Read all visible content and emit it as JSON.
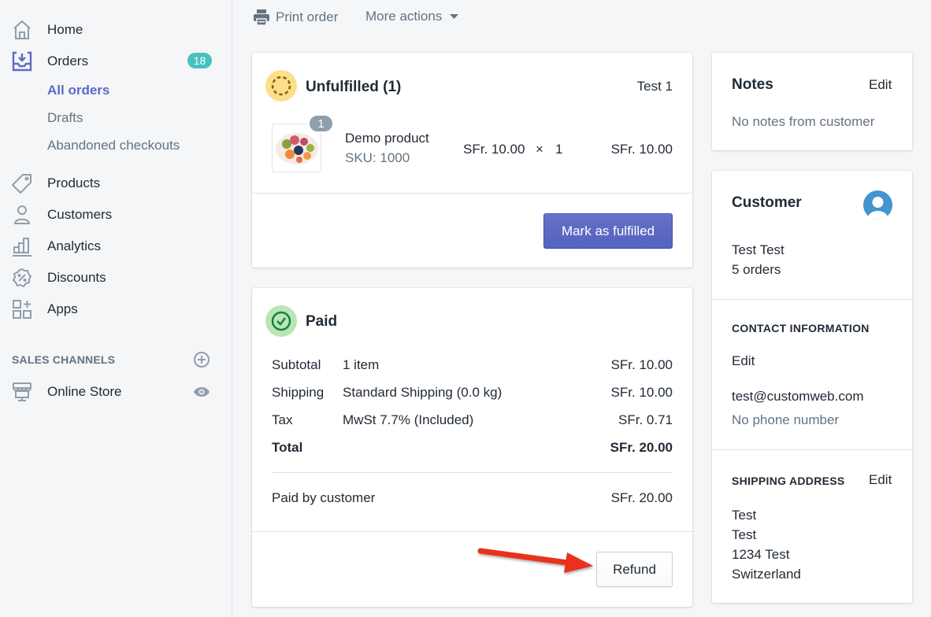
{
  "sidebar": {
    "items": [
      {
        "label": "Home",
        "icon": "home-icon"
      },
      {
        "label": "Orders",
        "icon": "orders-icon",
        "badge": "18"
      },
      {
        "label": "Products",
        "icon": "tag-icon"
      },
      {
        "label": "Customers",
        "icon": "person-icon"
      },
      {
        "label": "Analytics",
        "icon": "bar-chart-icon"
      },
      {
        "label": "Discounts",
        "icon": "discount-icon"
      },
      {
        "label": "Apps",
        "icon": "apps-icon"
      }
    ],
    "orders_sub": [
      {
        "label": "All orders",
        "active": true
      },
      {
        "label": "Drafts"
      },
      {
        "label": "Abandoned checkouts"
      }
    ],
    "sales_channels_title": "SALES CHANNELS",
    "online_store": "Online Store"
  },
  "toolbar": {
    "print": "Print order",
    "more_actions": "More actions"
  },
  "unfulfilled": {
    "title": "Unfulfilled (1)",
    "location": "Test 1",
    "product": {
      "name": "Demo product",
      "sku": "SKU: 1000",
      "quantity_badge": "1",
      "unit_price": "SFr. 10.00",
      "times": "×",
      "quantity": "1",
      "total": "SFr. 10.00"
    },
    "action": "Mark as fulfilled"
  },
  "paid": {
    "title": "Paid",
    "rows": [
      {
        "label": "Subtotal",
        "desc": "1 item",
        "amount": "SFr. 10.00"
      },
      {
        "label": "Shipping",
        "desc": "Standard Shipping (0.0 kg)",
        "amount": "SFr. 10.00"
      },
      {
        "label": "Tax",
        "desc": "MwSt 7.7% (Included)",
        "amount": "SFr. 0.71"
      }
    ],
    "total_label": "Total",
    "total_amount": "SFr. 20.00",
    "paid_by_label": "Paid by customer",
    "paid_by_amount": "SFr. 20.00",
    "action": "Refund"
  },
  "notes": {
    "title": "Notes",
    "edit": "Edit",
    "text": "No notes from customer"
  },
  "customer": {
    "title": "Customer",
    "name": "Test Test",
    "orders": "5 orders",
    "contact_title": "CONTACT INFORMATION",
    "contact_edit": "Edit",
    "email": "test@customweb.com",
    "phone": "No phone number",
    "shipping_title": "SHIPPING ADDRESS",
    "shipping_edit": "Edit",
    "address": [
      "Test",
      "Test",
      "1234 Test",
      "Switzerland"
    ]
  },
  "colors": {
    "accent": "#5c6ac4",
    "link": "#007ace",
    "badge": "#47c1bf",
    "annotation_arrow": "#e8321e"
  }
}
